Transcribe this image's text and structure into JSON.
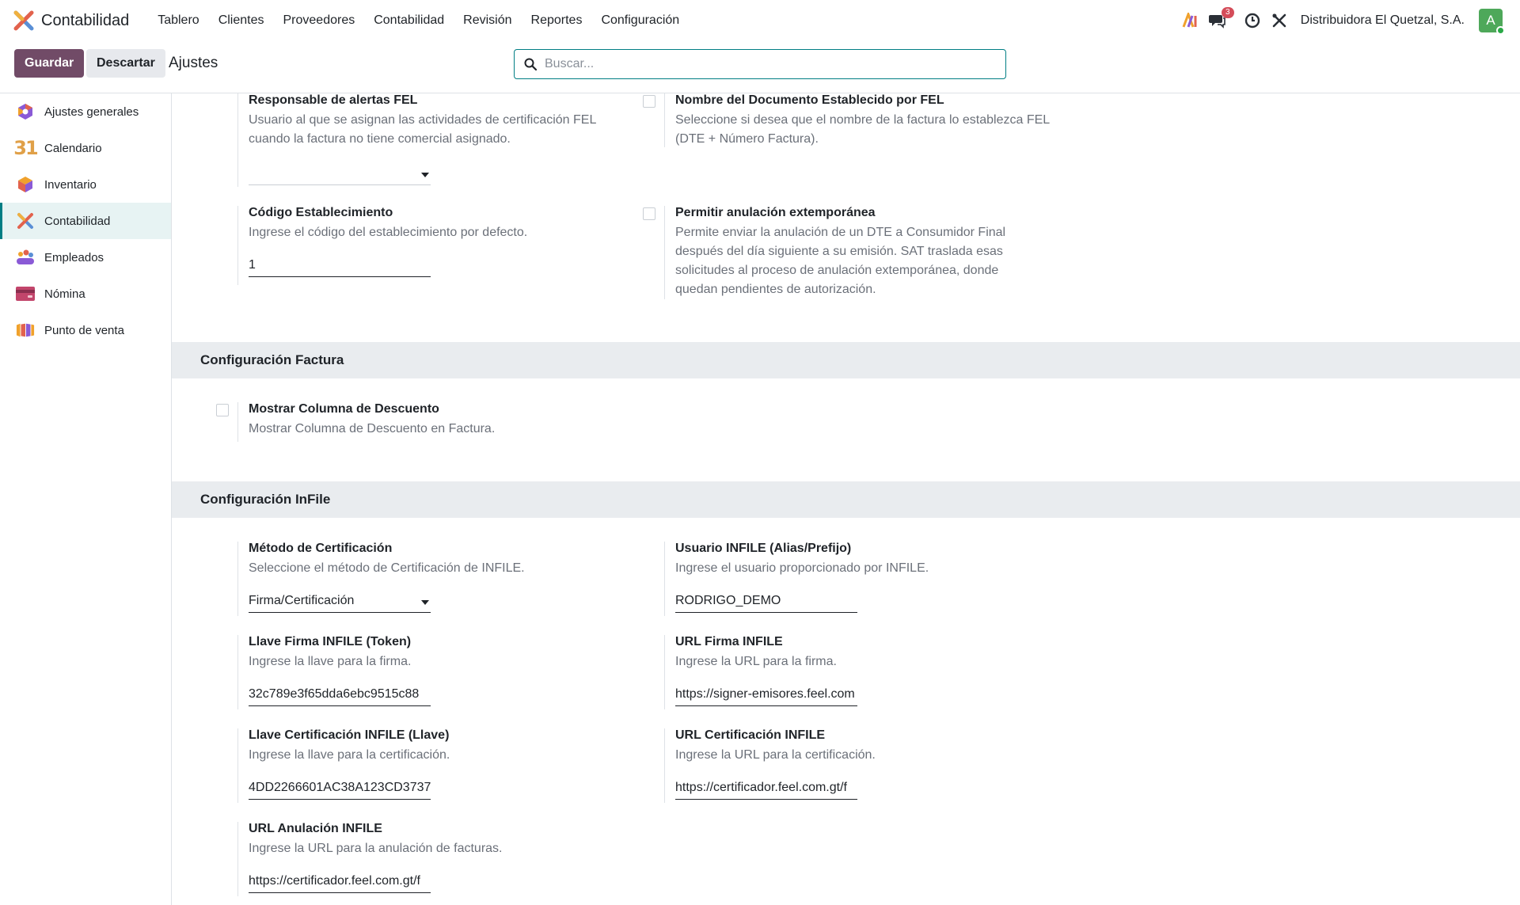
{
  "app": {
    "name": "Contabilidad"
  },
  "nav": {
    "menu": [
      {
        "label": "Tablero"
      },
      {
        "label": "Clientes"
      },
      {
        "label": "Proveedores"
      },
      {
        "label": "Contabilidad"
      },
      {
        "label": "Revisión"
      },
      {
        "label": "Reportes"
      },
      {
        "label": "Configuración"
      }
    ],
    "messages_badge": "3",
    "company": "Distribuidora El Quetzal, S.A.",
    "avatar_initial": "A"
  },
  "control_panel": {
    "save_label": "Guardar",
    "discard_label": "Descartar",
    "title": "Ajustes",
    "search_placeholder": "Buscar..."
  },
  "sidebar": {
    "items": [
      {
        "label": "Ajustes generales",
        "icon": "settings-app-icon"
      },
      {
        "label": "Calendario",
        "icon": "calendar-app-icon"
      },
      {
        "label": "Inventario",
        "icon": "inventory-app-icon"
      },
      {
        "label": "Contabilidad",
        "icon": "accounting-app-icon",
        "active": true
      },
      {
        "label": "Empleados",
        "icon": "employees-app-icon"
      },
      {
        "label": "Nómina",
        "icon": "payroll-app-icon"
      },
      {
        "label": "Punto de venta",
        "icon": "pos-app-icon"
      }
    ],
    "calendar_glyph": "31"
  },
  "fel": {
    "responsable": {
      "title": "Responsable de alertas FEL",
      "desc": "Usuario al que se asignan las actividades de certificación FEL cuando la factura no tiene comercial asignado.",
      "value": ""
    },
    "nombre_doc": {
      "title": "Nombre del Documento Establecido por FEL",
      "desc": "Seleccione si desea que el nombre de la factura lo establezca FEL (DTE + Número Factura).",
      "checked": false
    },
    "codigo": {
      "title": "Código Establecimiento",
      "desc": "Ingrese el código del establecimiento por defecto.",
      "value": "1"
    },
    "anulacion": {
      "title": "Permitir anulación extemporánea",
      "desc": "Permite enviar la anulación de un DTE a Consumidor Final después del día siguiente a su emisión. SAT traslada esas solicitudes al proceso de anulación extemporánea, donde quedan pendientes de autorización.",
      "checked": false
    }
  },
  "factura": {
    "header": "Configuración Factura",
    "descuento": {
      "title": "Mostrar Columna de Descuento",
      "desc": "Mostrar Columna de Descuento en Factura.",
      "checked": false
    }
  },
  "infile": {
    "header": "Configuración InFile",
    "metodo": {
      "title": "Método de Certificación",
      "desc": "Seleccione el método de Certificación de INFILE.",
      "value": "Firma/Certificación"
    },
    "usuario": {
      "title": "Usuario INFILE (Alias/Prefijo)",
      "desc": "Ingrese el usuario proporcionado por INFILE.",
      "value": "RODRIGO_DEMO"
    },
    "llave_firma": {
      "title": "Llave Firma INFILE (Token)",
      "desc": "Ingrese la llave para la firma.",
      "value": "32c789e3f65dda6ebc9515c88"
    },
    "url_firma": {
      "title": "URL Firma INFILE",
      "desc": "Ingrese la URL para la firma.",
      "value": "https://signer-emisores.feel.com"
    },
    "llave_cert": {
      "title": "Llave Certificación INFILE (Llave)",
      "desc": "Ingrese la llave para la certificación.",
      "value": "4DD2266601AC38A123CD3737"
    },
    "url_cert": {
      "title": "URL Certificación INFILE",
      "desc": "Ingrese la URL para la certificación.",
      "value": "https://certificador.feel.com.gt/f"
    },
    "url_anul": {
      "title": "URL Anulación INFILE",
      "desc": "Ingrese la URL para la anulación de facturas.",
      "value": "https://certificador.feel.com.gt/f"
    }
  },
  "colors": {
    "brand": "#714b67",
    "accent": "#017e84",
    "badge": "#d44c59",
    "avatar": "#4ea85a"
  }
}
